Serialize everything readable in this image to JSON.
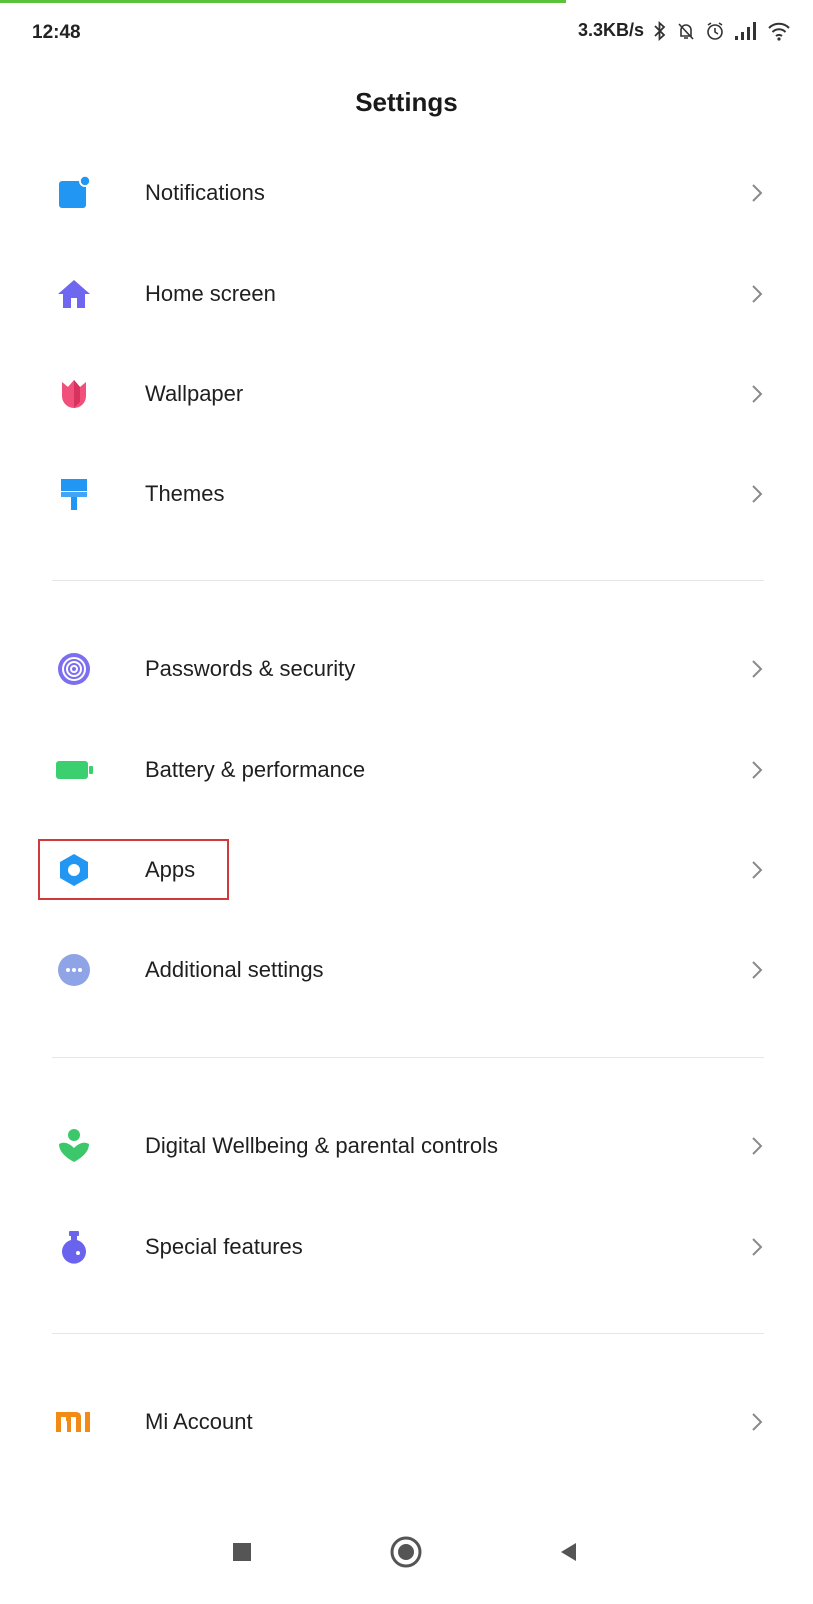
{
  "status_bar": {
    "time": "12:48",
    "network_speed": "3.3KB/s",
    "icons": [
      "bluetooth-icon",
      "notifications-off-icon",
      "alarm-icon",
      "signal-icon",
      "wifi-icon"
    ]
  },
  "header": {
    "title": "Settings"
  },
  "settings_items": [
    {
      "label": "Notifications",
      "icon": "notifications-icon",
      "color": "#2196f3"
    },
    {
      "label": "Home screen",
      "icon": "home-icon",
      "color": "#6f67f0"
    },
    {
      "label": "Wallpaper",
      "icon": "wallpaper-tulip-icon",
      "color": "#f0507a"
    },
    {
      "label": "Themes",
      "icon": "themes-brush-icon",
      "color": "#2196f3"
    },
    {
      "label": "Passwords & security",
      "icon": "fingerprint-icon",
      "color": "#7c6ef0"
    },
    {
      "label": "Battery & performance",
      "icon": "battery-icon",
      "color": "#3ccf70"
    },
    {
      "label": "Apps",
      "icon": "apps-gear-icon",
      "color": "#2196f3"
    },
    {
      "label": "Additional settings",
      "icon": "more-dots-icon",
      "color": "#8fa4e6"
    },
    {
      "label": "Digital Wellbeing & parental controls",
      "icon": "wellbeing-icon",
      "color": "#3cc86a"
    },
    {
      "label": "Special features",
      "icon": "special-features-flask-icon",
      "color": "#6a63ee"
    },
    {
      "label": "Mi Account",
      "icon": "mi-logo-icon",
      "color": "#f28a16"
    }
  ],
  "highlighted_item": "Apps",
  "highlight_color": "#d03a3a",
  "nav_bar": {
    "buttons": [
      "recents-square-icon",
      "home-circle-icon",
      "back-triangle-icon"
    ]
  }
}
